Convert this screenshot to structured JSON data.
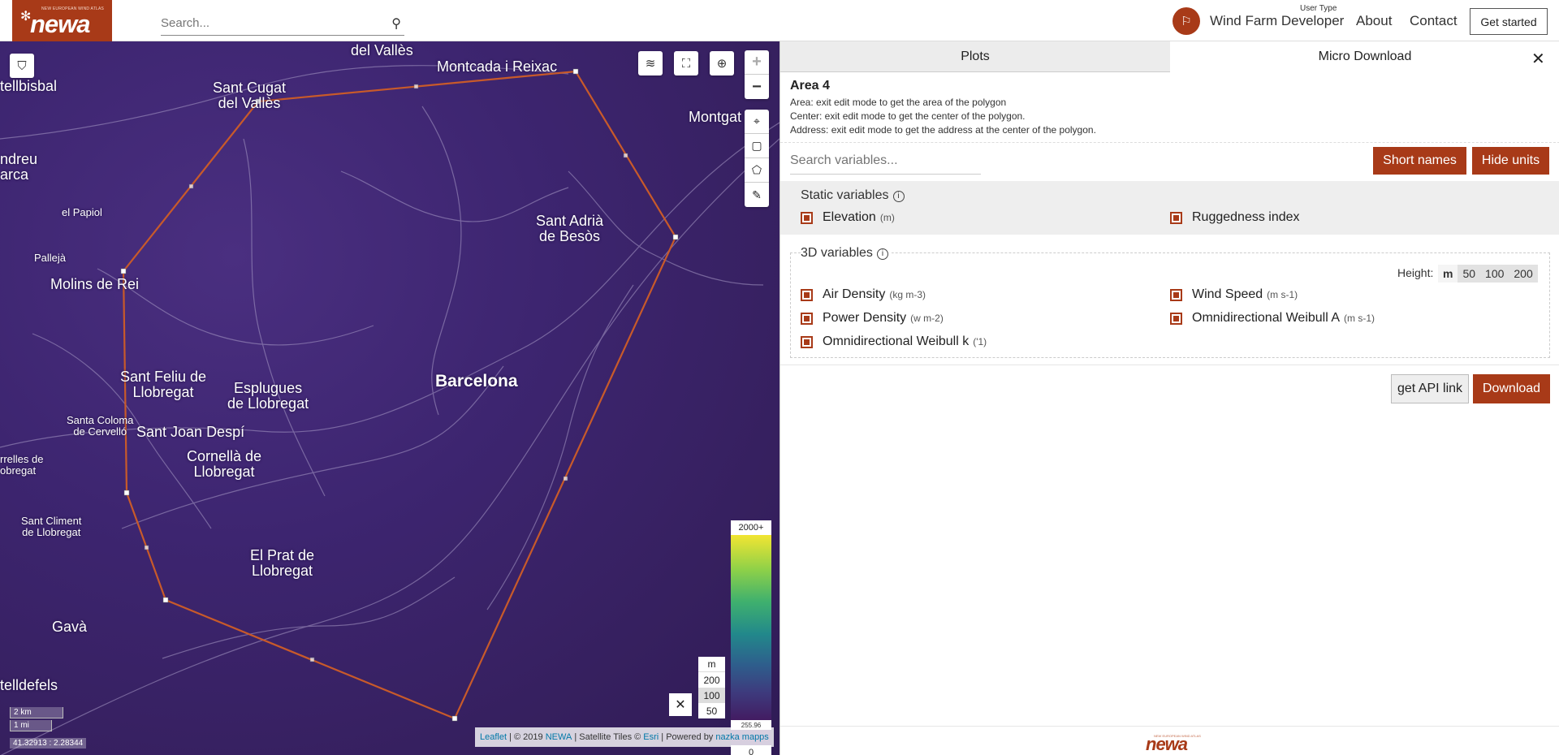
{
  "header": {
    "logo_big": "newa",
    "logo_small": "NEW EUROPEAN WIND ATLAS",
    "search_placeholder": "Search...",
    "user_type_label": "User Type",
    "user_role": "Wind Farm Developer",
    "nav": [
      "About",
      "Contact"
    ],
    "get_started": "Get started"
  },
  "map": {
    "places": [
      {
        "name": "del Vallès",
        "size": "md"
      },
      {
        "name": "Montcada i Reixac",
        "size": "md"
      },
      {
        "name": "Sant Cugat\ndel Vallès",
        "size": "md"
      },
      {
        "name": "Montgat",
        "size": "md"
      },
      {
        "name": "tellbisbal",
        "size": "md"
      },
      {
        "name": "ndreu\narca",
        "size": "md"
      },
      {
        "name": "el Papiol",
        "size": "sm"
      },
      {
        "name": "Sant Adrià\nde Besòs",
        "size": "md"
      },
      {
        "name": "Pallejà",
        "size": "sm"
      },
      {
        "name": "Molins de Rei",
        "size": "md"
      },
      {
        "name": "Barcelona",
        "size": "lg"
      },
      {
        "name": "Sant Feliu de\nLlobregat",
        "size": "md"
      },
      {
        "name": "Esplugues\nde Llobregat",
        "size": "md"
      },
      {
        "name": "Santa Coloma\nde Cervelló",
        "size": "sm"
      },
      {
        "name": "Sant Joan Despí",
        "size": "md"
      },
      {
        "name": "Cornellà de\nLlobregat",
        "size": "md"
      },
      {
        "name": "rrelles de\nobregat",
        "size": "sm"
      },
      {
        "name": "Sant Climent\nde Llobregat",
        "size": "sm"
      },
      {
        "name": "El Prat de\nLlobregat",
        "size": "md"
      },
      {
        "name": "Gavà",
        "size": "md"
      },
      {
        "name": "telldefels",
        "size": "md"
      }
    ],
    "legend": {
      "top": "2000+",
      "marker": "255.96",
      "bottom": "0"
    },
    "height_selector": {
      "unit": "m",
      "options": [
        "200",
        "100",
        "50"
      ],
      "selected": "100"
    },
    "scale": {
      "km": "2 km",
      "mi": "1 mi"
    },
    "coords": "41.32913 : 2.28344",
    "attribution": {
      "leaflet": "Leaflet",
      "copy": " | © 2019 ",
      "newa": "NEWA",
      "tiles": " | Satellite Tiles © ",
      "esri": "Esri",
      "powered": " | Powered by ",
      "nazka": "nazka mapps"
    }
  },
  "panel": {
    "tabs": [
      "Plots",
      "Micro Download"
    ],
    "area_title": "Area 4",
    "area_info": [
      "Area: exit edit mode to get the area of the polygon",
      "Center: exit edit mode to get the center of the polygon.",
      "Address: exit edit mode to get the address at the center of the polygon."
    ],
    "search_vars_placeholder": "Search variables...",
    "btn_short_names": "Short names",
    "btn_hide_units": "Hide units",
    "static_title": "Static variables",
    "static_vars": [
      {
        "label": "Elevation",
        "unit": "(m)"
      },
      {
        "label": "Ruggedness index",
        "unit": ""
      }
    ],
    "vars3d_title": "3D variables",
    "height_label": "Height:",
    "height_options": [
      "m",
      "50",
      "100",
      "200"
    ],
    "vars3d": [
      {
        "label": "Air Density",
        "unit": "(kg m-3)"
      },
      {
        "label": "Wind Speed",
        "unit": "(m s-1)"
      },
      {
        "label": "Power Density",
        "unit": "(w m-2)"
      },
      {
        "label": "Omnidirectional Weibull A",
        "unit": "(m s-1)"
      },
      {
        "label": "Omnidirectional Weibull k",
        "unit": "('1)"
      }
    ],
    "btn_api": "get API link",
    "btn_download": "Download",
    "footer_logo": "newa",
    "footer_logo_small": "NEW EUROPEAN WIND ATLAS"
  }
}
